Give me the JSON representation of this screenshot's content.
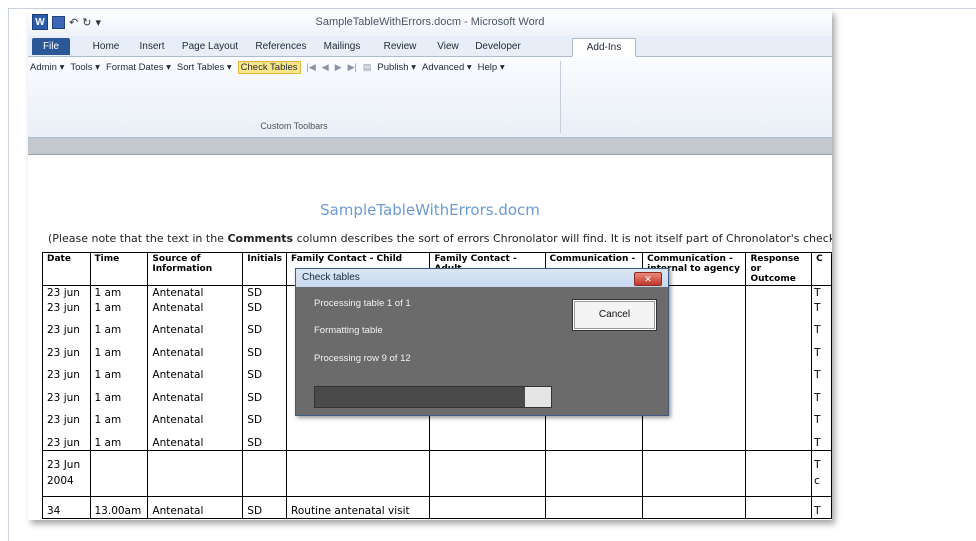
{
  "window": {
    "title": "SampleTableWithErrors.docm - Microsoft Word",
    "word_icon": "W",
    "qat_icons": [
      "save-icon",
      "undo-icon",
      "redo-icon",
      "customize-icon"
    ]
  },
  "tabs": [
    "File",
    "Home",
    "Insert",
    "Page Layout",
    "References",
    "Mailings",
    "Review",
    "View",
    "Developer",
    "Add-Ins"
  ],
  "active_tab": "Add-Ins",
  "ribbon": {
    "items": [
      "Admin ▾",
      "Tools ▾",
      "Format Dates ▾",
      "Sort Tables ▾",
      "Check Tables"
    ],
    "items_right": [
      "Publish ▾",
      "Advanced ▾",
      "Help ▾"
    ],
    "group_label": "Custom Toolbars"
  },
  "document": {
    "title": "SampleTableWithErrors.docm",
    "note_pre": "(Please note that the text in the ",
    "note_bold": "Comments",
    "note_post": " column describes the sort of errors Chronolator will find. It is not itself part of Chronolator's checking).",
    "table_headers": [
      "Date",
      "Time",
      "Source of Information",
      "Initials",
      "Family Contact - Child",
      "Family Contact - Adult",
      "Communication -",
      "Communication - internal to agency",
      "Response or Outcome",
      "C"
    ],
    "rows": [
      [
        "23 jun",
        "1 am",
        "Antenatal",
        "SD",
        "T"
      ],
      [
        "23 jun",
        "1 am",
        "Antenatal",
        "SD",
        "T"
      ],
      [
        "23 jun",
        "1 am",
        "Antenatal",
        "SD",
        "T"
      ],
      [
        "23 jun",
        "1 am",
        "Antenatal",
        "SD",
        "T"
      ],
      [
        "23 jun",
        "1 am",
        "Antenatal",
        "SD",
        "T"
      ],
      [
        "23 jun",
        "1 am",
        "Antenatal",
        "SD",
        "T"
      ],
      [
        "23 jun",
        "1 am",
        "Antenatal",
        "SD",
        "T"
      ],
      [
        "23 jun",
        "1 am",
        "Antenatal",
        "SD",
        "T"
      ]
    ],
    "row_23jun_2004": {
      "date_line1": "23 Jun",
      "date_line2": "2004",
      "last": "T",
      "last2": "c"
    },
    "row_34": {
      "date": "34",
      "time": "13.00am",
      "source": "Antenatal",
      "initials": "SD",
      "contact": "Routine antenatal visit",
      "last": "T"
    }
  },
  "dialog": {
    "title": "Check tables",
    "close_label": "✕",
    "line1": "Processing table 1 of 1",
    "line2": "Formatting table",
    "line3": "Processing row  9 of 12",
    "cancel_label": "Cancel",
    "progress_fraction": 0.89
  }
}
